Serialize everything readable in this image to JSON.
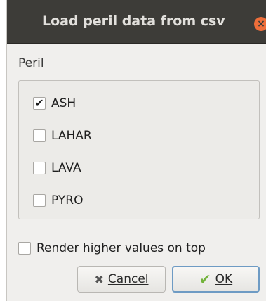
{
  "window": {
    "title": "Load peril data from csv",
    "close_glyph": "×"
  },
  "peril_group": {
    "label": "Peril",
    "options": [
      {
        "label": "ASH",
        "checked": true
      },
      {
        "label": "LAHAR",
        "checked": false
      },
      {
        "label": "LAVA",
        "checked": false
      },
      {
        "label": "PYRO",
        "checked": false
      }
    ]
  },
  "render_option": {
    "label": "Render higher values on top",
    "checked": false
  },
  "buttons": {
    "cancel_label": "Cancel",
    "ok_label": "OK"
  },
  "icons": {
    "check_mark": "✔",
    "cancel_x": "✖",
    "ok_check": "✔"
  },
  "colors": {
    "titlebar": "#3d3c38",
    "close_button": "#ee6e3a",
    "ok_border": "#6e9bc4",
    "ok_check": "#72b33b"
  }
}
